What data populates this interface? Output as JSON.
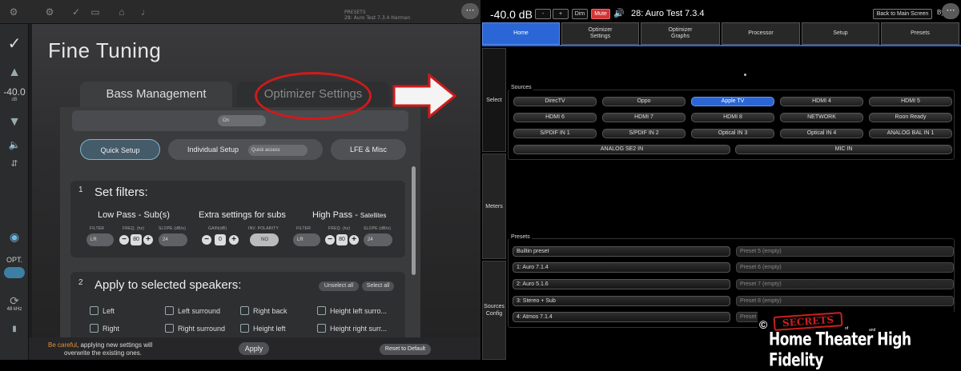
{
  "left_app": {
    "title": "Fine Tuning",
    "preset_header_line1": "PRESETS",
    "preset_header_line2": "28: Auro Test 7.3.4 Harman",
    "volume": "-40.0",
    "volume_unit": "dB",
    "opt_label": "OPT.",
    "sample_rate": "48 kHz",
    "tabs": [
      {
        "label": "Bass Management",
        "active": true
      },
      {
        "label": "Optimizer Settings",
        "active": false
      }
    ],
    "on_select": "On",
    "buttons": {
      "quick_setup": "Quick Setup",
      "individual_setup": "Individual Setup",
      "quick_access": "Quick access",
      "lfe_misc": "LFE & Misc"
    },
    "section1": {
      "num": "1",
      "heading": "Set filters:",
      "low_pass": {
        "title": "Low Pass - Sub(s)",
        "filter_label": "FILTER",
        "filter": "LR",
        "freq_label": "FREQ. (hz)",
        "freq": "80",
        "slope_label": "SLOPE (dB/o)",
        "slope": "24"
      },
      "extra": {
        "title": "Extra settings for subs",
        "gain_label": "GAIN(dB)",
        "gain": "0",
        "inv_label": "INV. POLARITY",
        "inv": "NO"
      },
      "high_pass": {
        "title": "High Pass -",
        "title_suffix": "Satellites",
        "filter_label": "FILTER",
        "filter": "LR",
        "freq_label": "FREQ. (hz)",
        "freq": "80",
        "slope_label": "SLOPE (dB/o)",
        "slope": "24"
      }
    },
    "section2": {
      "num": "2",
      "heading": "Apply to selected speakers:",
      "unselect_all": "Unselect all",
      "select_all": "Select all",
      "speakers": [
        "Left",
        "Left surround",
        "Right back",
        "Height left surro...",
        "Right",
        "Right surround",
        "Height left",
        "Height right surr..."
      ]
    },
    "warning_highlight": "Be careful",
    "warning_rest": ", applying new settings will",
    "warning_line2": "overwrite the existing ones.",
    "apply": "Apply",
    "reset": "Reset to Default",
    "more": "⋯"
  },
  "right_app": {
    "volume": "-40.0 dB",
    "vol_minus": "-",
    "vol_plus": "+",
    "dim": "Dim",
    "mute": "Mute",
    "preset_name": "28: Auro Test 7.3.4",
    "back": "Back to Main Screen",
    "by": "By",
    "more": "⋯",
    "nav_tabs": [
      {
        "line1": "Home",
        "line2": "",
        "active": true
      },
      {
        "line1": "Optimizer",
        "line2": "Settings",
        "active": false
      },
      {
        "line1": "Optimizer",
        "line2": "Graphs",
        "active": false
      },
      {
        "line1": "Processor",
        "line2": "",
        "active": false
      },
      {
        "line1": "Setup",
        "line2": "",
        "active": false
      },
      {
        "line1": "Presets",
        "line2": "",
        "active": false
      }
    ],
    "side_tabs": [
      {
        "line1": "Select",
        "line2": "",
        "active": true
      },
      {
        "line1": "Meters",
        "line2": "",
        "active": false
      },
      {
        "line1": "Sources",
        "line2": "Config",
        "active": false
      }
    ],
    "sources_label": "Sources",
    "sources": [
      "DirecTV",
      "Oppo",
      "Apple TV",
      "HDMI 4",
      "HDMI 5",
      "HDMI 6",
      "HDMI 7",
      "HDMI 8",
      "NETWORK",
      "Roon Ready",
      "S/PDIF IN 1",
      "S/PDIF IN 2",
      "Optical IN 3",
      "Optical IN 4",
      "ANALOG BAL IN 1",
      "ANALOG SE2 IN",
      "MIC IN"
    ],
    "selected_source": "Apple TV",
    "presets_label": "Presets",
    "presets_left": [
      "Builtin preset",
      "1: Auro 7.1.4",
      "2: Auro 5.1.6",
      "3: Stereo + Sub",
      "4: Atmos 7.1.4"
    ],
    "presets_right": [
      "Preset 5 (empty)",
      "Preset 6 (empty)",
      "Preset 7 (empty)",
      "Preset 8 (empty)",
      "Preset"
    ]
  },
  "watermark": {
    "copyright": "©",
    "secrets": "SECRETS",
    "of": "of",
    "and": "and",
    "line": "Home Theater High Fidelity"
  },
  "colors": {
    "accent_blue": "#2a66d6",
    "mute_red": "#d43434",
    "annotation_red": "#d11a1a",
    "warning_orange": "#e2913a"
  }
}
